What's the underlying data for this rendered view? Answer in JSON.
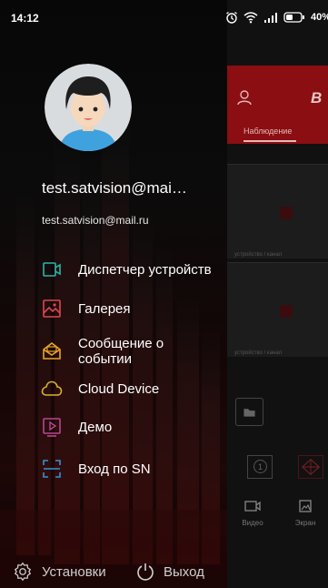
{
  "status_bar": {
    "time": "14:12",
    "battery": "40%",
    "icons": [
      "alarm-icon",
      "wifi-icon",
      "signal-icon",
      "battery-icon"
    ]
  },
  "drawer": {
    "user_name": "test.satvision@mai…",
    "user_email": "test.satvision@mail.ru",
    "menu": [
      {
        "id": "devices",
        "label": "Диспетчер устройств",
        "icon": "camera-icon",
        "color": "#2bb5a8"
      },
      {
        "id": "gallery",
        "label": "Галерея",
        "icon": "image-icon",
        "color": "#e0454f"
      },
      {
        "id": "events",
        "label": "Сообщение о\nсобытии",
        "icon": "message-icon",
        "color": "#e8a52b"
      },
      {
        "id": "cloud",
        "label": "Cloud Device",
        "icon": "cloud-icon",
        "color": "#d8b12a"
      },
      {
        "id": "demo",
        "label": "Демо",
        "icon": "play-icon",
        "color": "#b5478f"
      },
      {
        "id": "sn",
        "label": "Вход по SN",
        "icon": "scan-icon",
        "color": "#3a8fd6"
      }
    ],
    "footer": {
      "settings_label": "Установки",
      "logout_label": "Выход"
    }
  },
  "background_app": {
    "brand": "B",
    "tab_label": "Наблюдение",
    "cell_caption": "устройство / канал",
    "nav": [
      {
        "label": "Видео",
        "icon": "video-icon"
      },
      {
        "label": "Экран",
        "icon": "screenshot-icon"
      }
    ]
  }
}
